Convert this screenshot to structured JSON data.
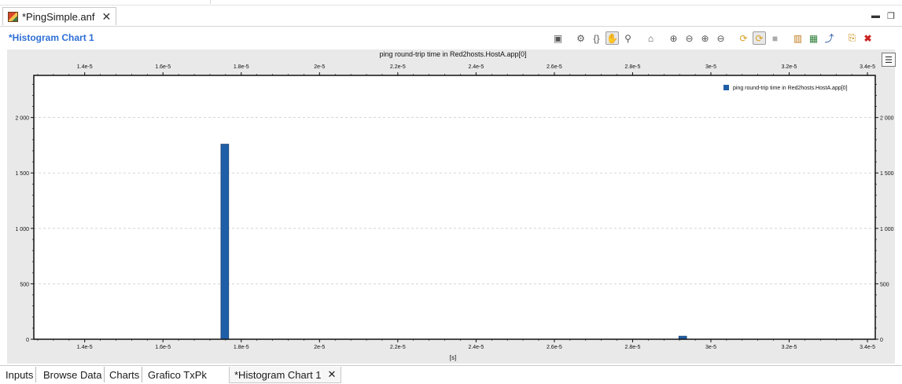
{
  "editor": {
    "tab_label": "*PingSimple.anf",
    "tab_close": "✕",
    "minimize": "▬",
    "maximize": "❐"
  },
  "toolbar": {
    "chart_name": "*Histogram Chart 1",
    "icons": [
      "save-icon",
      "gear-icon",
      "braces-icon",
      "hand-pan-icon",
      "zoom-tool-icon",
      "home-icon",
      "zoom-in-icon",
      "zoom-out-icon",
      "zoom-in-x-icon",
      "zoom-out-x-icon",
      "refresh-icon",
      "auto-refresh-icon",
      "stop-icon",
      "copy-chart-icon",
      "copy-data-icon",
      "export-icon",
      "copy-image-icon",
      "close-chart-icon"
    ]
  },
  "bottom_tabs": [
    {
      "label": "Inputs"
    },
    {
      "label": "Browse Data"
    },
    {
      "label": "Charts"
    },
    {
      "label": "Grafico TxPk"
    },
    {
      "label": "*Histogram Chart 1",
      "close": "✕"
    }
  ],
  "chart_data": {
    "type": "bar",
    "title": "ping round-trip time in Red2hosts.HostA.app[0]",
    "xlabel": "[s]",
    "ylabel": "",
    "xlim": [
      1.27e-05,
      3.42e-05
    ],
    "ylim": [
      0,
      2380
    ],
    "xticks": [
      1.4e-05,
      1.6e-05,
      1.8e-05,
      2e-05,
      2.2e-05,
      2.4e-05,
      2.6e-05,
      2.8e-05,
      3e-05,
      3.2e-05,
      3.4e-05
    ],
    "xtick_labels": [
      "1.4e-5",
      "1.6e-5",
      "1.8e-5",
      "2e-5",
      "2.2e-5",
      "2.4e-5",
      "2.6e-5",
      "2.8e-5",
      "3e-5",
      "3.2e-5",
      "3.4e-5"
    ],
    "yticks": [
      0,
      500,
      1000,
      1500,
      2000
    ],
    "ytick_labels": [
      "0",
      "500",
      "1 000",
      "1 500",
      "2 000"
    ],
    "grid": true,
    "legend": "top-right",
    "series": [
      {
        "name": "ping round-trip time in Red2hosts.HostA.app[0]",
        "color": "#1f5fa8",
        "bins": [
          {
            "x0": 1.748e-05,
            "x1": 1.768e-05,
            "value": 1760
          },
          {
            "x0": 2.918e-05,
            "x1": 2.938e-05,
            "value": 28
          }
        ]
      }
    ]
  }
}
